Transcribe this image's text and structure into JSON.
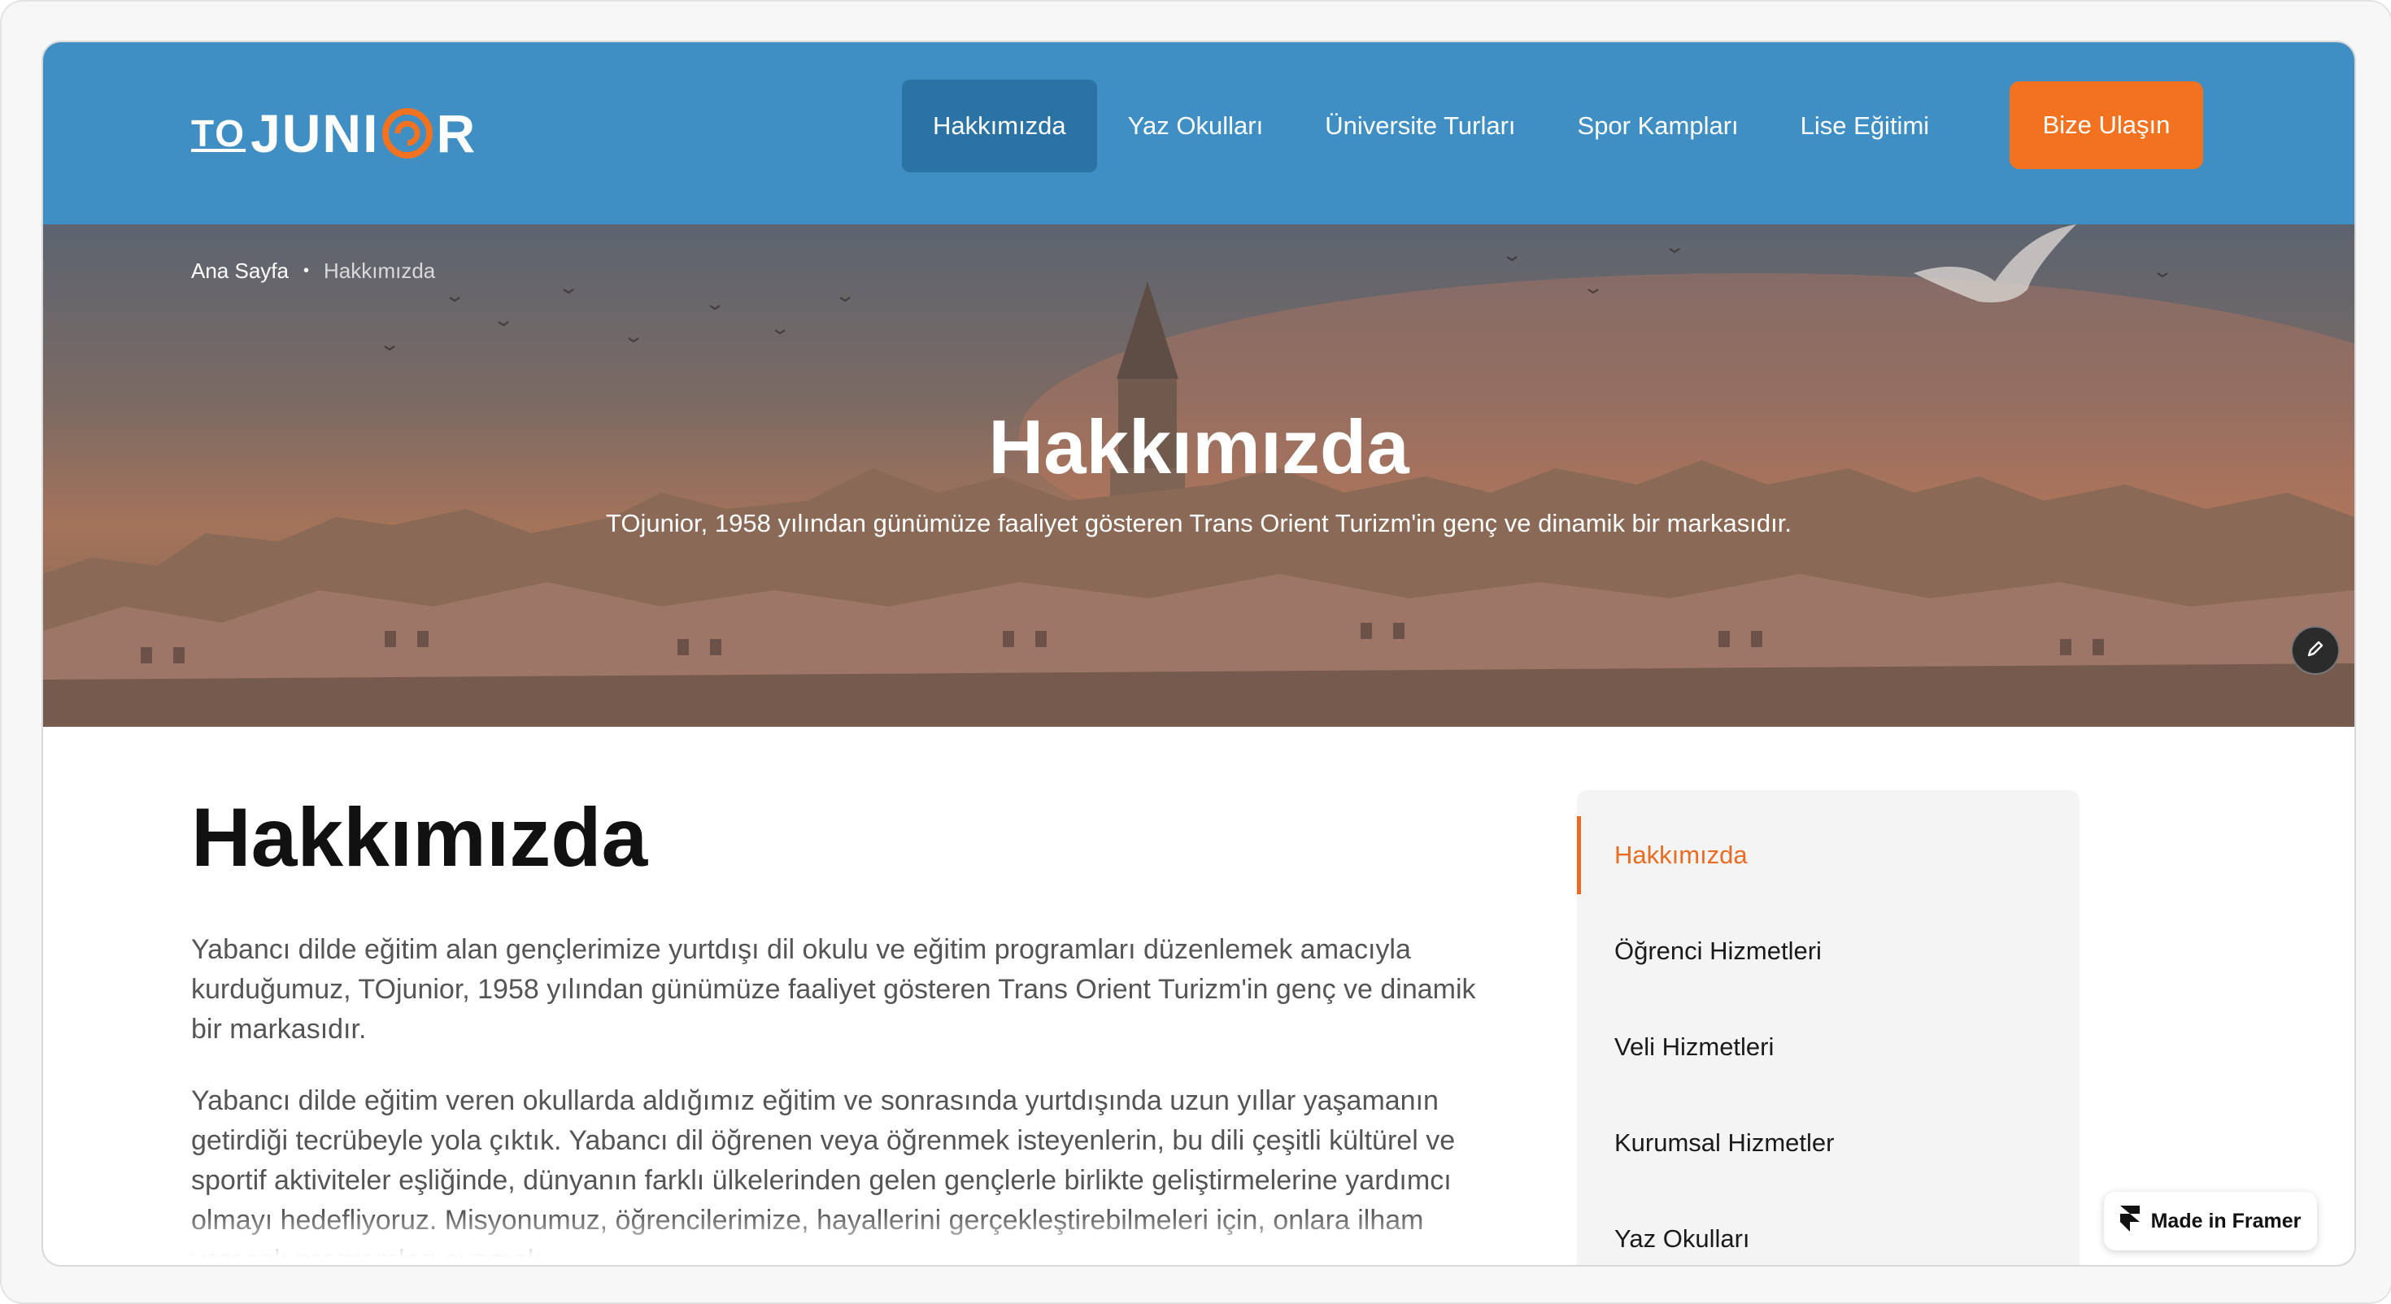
{
  "brand": {
    "logo_text_to": "TO",
    "logo_text_main": "JUNI",
    "logo_text_end": "R",
    "accent": "#f27220",
    "header_bg": "#3f8fc4"
  },
  "nav": {
    "items": [
      {
        "label": "Hakkımızda",
        "active": true
      },
      {
        "label": "Yaz Okulları"
      },
      {
        "label": "Üniversite Turları"
      },
      {
        "label": "Spor Kampları"
      },
      {
        "label": "Lise Eğitimi"
      }
    ],
    "cta": "Bize Ulaşın"
  },
  "breadcrumb": {
    "home": "Ana Sayfa",
    "separator": "•",
    "current": "Hakkımızda"
  },
  "hero": {
    "title": "Hakkımızda",
    "subtitle": "TOjunior, 1958 yılından günümüze faaliyet gösteren Trans Orient Turizm'in genç ve dinamik bir markasıdır."
  },
  "main": {
    "title": "Hakkımızda",
    "paragraphs": [
      "Yabancı dilde eğitim alan gençlerimize yurtdışı dil okulu ve eğitim programları düzenlemek amacıyla kurduğumuz, TOjunior, 1958 yılından günümüze faaliyet gösteren Trans Orient Turizm'in genç ve dinamik bir markasıdır.",
      "Yabancı dilde eğitim veren okullarda aldığımız eğitim ve sonrasında yurtdışında uzun yıllar yaşamanın getirdiği tecrübeyle yola çıktık. Yabancı dil öğrenen veya öğrenmek isteyenlerin, bu dili çeşitli kültürel ve sportif aktiviteler eşliğinde, dünyanın farklı ülkelerinden gelen gençlerle birlikte geliştirmelerine yardımcı olmayı hedefliyoruz. Misyonumuz, öğrencilerimize, hayallerini gerçekleştirebilmeleri için, onlara ilham verecek programları sunmak."
    ]
  },
  "sidebar": {
    "items": [
      {
        "label": "Hakkımızda",
        "active": true
      },
      {
        "label": "Öğrenci Hizmetleri"
      },
      {
        "label": "Veli Hizmetleri"
      },
      {
        "label": "Kurumsal Hizmetler"
      },
      {
        "label": "Yaz Okulları"
      }
    ]
  },
  "badge": {
    "label": "Made in Framer",
    "icon": "framer-icon"
  },
  "icons": {
    "edit": "pencil-icon",
    "logo_swirl": "swirl-icon"
  }
}
